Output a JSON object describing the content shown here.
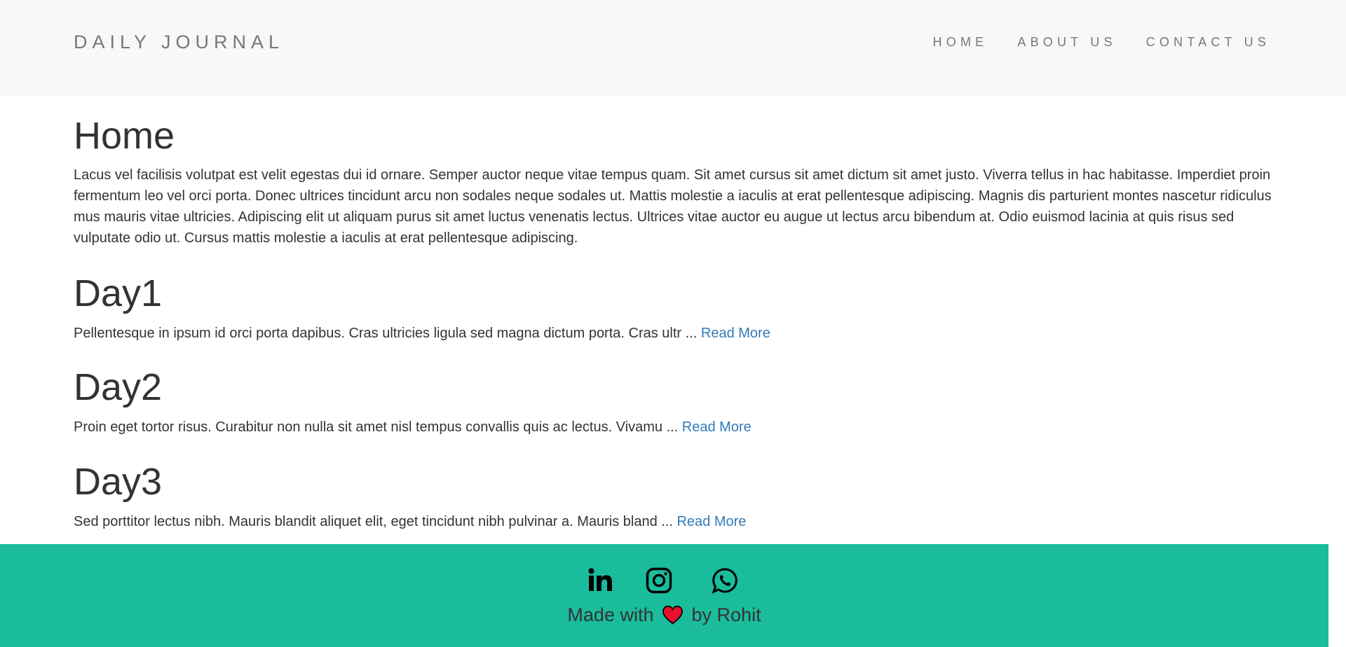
{
  "navbar": {
    "brand": "DAILY JOURNAL",
    "items": [
      {
        "label": "HOME"
      },
      {
        "label": "ABOUT US"
      },
      {
        "label": "CONTACT US"
      }
    ]
  },
  "main": {
    "title": "Home",
    "intro": "Lacus vel facilisis volutpat est velit egestas dui id ornare. Semper auctor neque vitae tempus quam. Sit amet cursus sit amet dictum sit amet justo. Viverra tellus in hac habitasse. Imperdiet proin fermentum leo vel orci porta. Donec ultrices tincidunt arcu non sodales neque sodales ut. Mattis molestie a iaculis at erat pellentesque adipiscing. Magnis dis parturient montes nascetur ridiculus mus mauris vitae ultricies. Adipiscing elit ut aliquam purus sit amet luctus venenatis lectus. Ultrices vitae auctor eu augue ut lectus arcu bibendum at. Odio euismod lacinia at quis risus sed vulputate odio ut. Cursus mattis molestie a iaculis at erat pellentesque adipiscing.",
    "posts": [
      {
        "title": "Day1",
        "excerpt": "Pellentesque in ipsum id orci porta dapibus. Cras ultricies ligula sed magna dictum porta. Cras ultr ... ",
        "link": "Read More"
      },
      {
        "title": "Day2",
        "excerpt": "Proin eget tortor risus. Curabitur non nulla sit amet nisl tempus convallis quis ac lectus. Vivamu ... ",
        "link": "Read More"
      },
      {
        "title": "Day3",
        "excerpt": "Sed porttitor lectus nibh. Mauris blandit aliquet elit, eget tincidunt nibh pulvinar a. Mauris bland ... ",
        "link": "Read More"
      }
    ]
  },
  "footer": {
    "icons": [
      "linkedin-icon",
      "instagram-icon",
      "whatsapp-icon"
    ],
    "made_prefix": "Made with",
    "made_suffix": "by Rohit",
    "heart_icon": "heart-icon",
    "colors": {
      "footer_bg": "#1abc9c",
      "link": "#337ab7",
      "heart": "#e8112d"
    }
  }
}
